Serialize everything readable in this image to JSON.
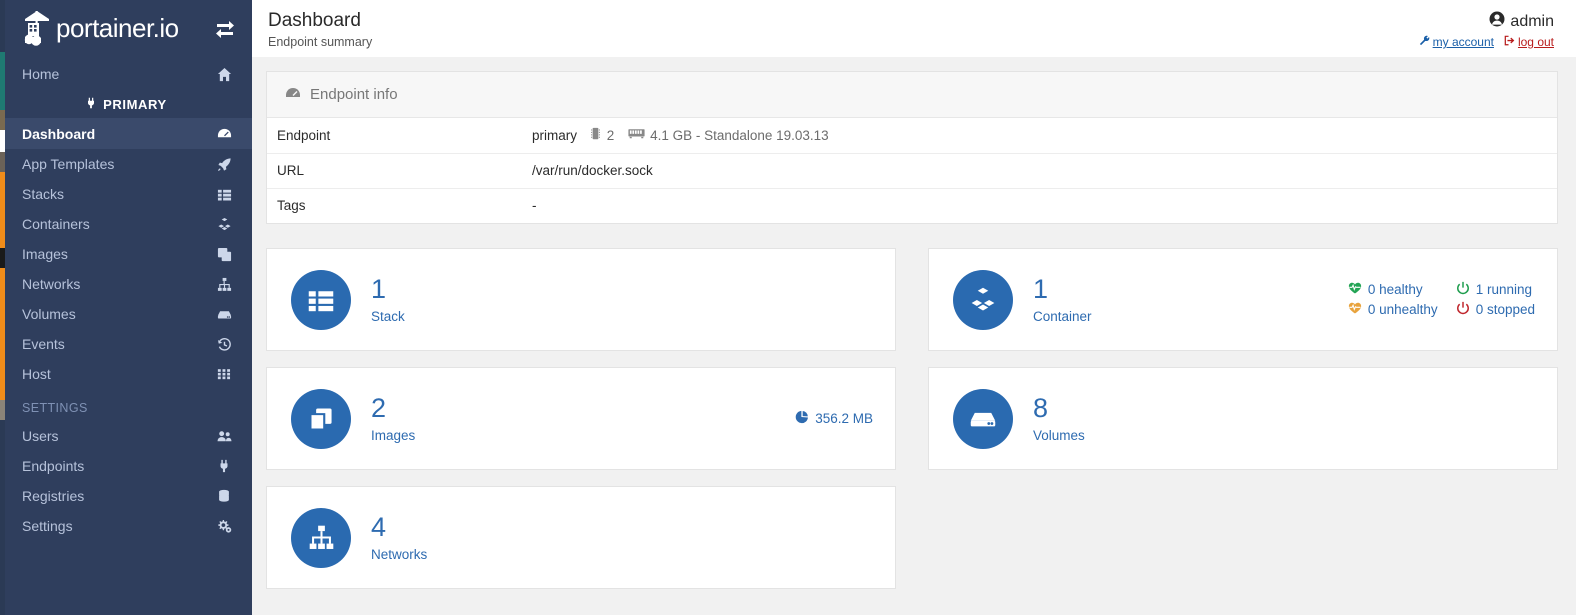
{
  "brand": {
    "name": "portainer.io",
    "toggle_icon": "exchange-arrows-icon"
  },
  "sidebar": {
    "home": {
      "label": "Home",
      "icon": "home-icon"
    },
    "primary_badge": {
      "label": "PRIMARY",
      "icon": "plug-icon"
    },
    "items": [
      {
        "label": "Dashboard",
        "icon": "tachometer-icon",
        "active": true
      },
      {
        "label": "App Templates",
        "icon": "rocket-icon",
        "active": false
      },
      {
        "label": "Stacks",
        "icon": "th-list-icon",
        "active": false
      },
      {
        "label": "Containers",
        "icon": "cubes-icon",
        "active": false
      },
      {
        "label": "Images",
        "icon": "clone-icon",
        "active": false
      },
      {
        "label": "Networks",
        "icon": "sitemap-icon",
        "active": false
      },
      {
        "label": "Volumes",
        "icon": "hdd-icon",
        "active": false
      },
      {
        "label": "Events",
        "icon": "history-icon",
        "active": false
      },
      {
        "label": "Host",
        "icon": "th-icon",
        "active": false
      }
    ],
    "settings_section": "SETTINGS",
    "settings_items": [
      {
        "label": "Users",
        "icon": "users-icon"
      },
      {
        "label": "Endpoints",
        "icon": "plug-icon"
      },
      {
        "label": "Registries",
        "icon": "database-icon"
      },
      {
        "label": "Settings",
        "icon": "cogs-icon"
      }
    ]
  },
  "header": {
    "title": "Dashboard",
    "subtitle": "Endpoint summary",
    "user": "admin",
    "user_icon": "user-circle-icon",
    "my_account": "my account",
    "my_account_icon": "wrench-icon",
    "log_out": "log out",
    "log_out_icon": "sign-out-icon"
  },
  "endpoint_panel": {
    "title": "Endpoint info",
    "title_icon": "tachometer-icon",
    "rows": [
      {
        "key": "Endpoint",
        "value": "primary"
      },
      {
        "key": "URL",
        "value": "/var/run/docker.sock"
      },
      {
        "key": "Tags",
        "value": "-"
      }
    ],
    "cpu_icon": "memory-icon",
    "cpu_count": "2",
    "ram_icon": "ram-icon",
    "ram_info": "4.1 GB - Standalone 19.03.13"
  },
  "cards": {
    "stack": {
      "count": "1",
      "label": "Stack",
      "icon": "th-list-icon"
    },
    "container": {
      "count": "1",
      "label": "Container",
      "icon": "cubes-icon",
      "stats": [
        {
          "label": "0 healthy",
          "icon": "heartbeat-icon",
          "color": "#23a455"
        },
        {
          "label": "1 running",
          "icon": "power-icon",
          "color": "#1f9d4e"
        },
        {
          "label": "0 unhealthy",
          "icon": "heartbeat-icon",
          "color": "#e8a33d"
        },
        {
          "label": "0 stopped",
          "icon": "power-icon",
          "color": "#c0272d"
        }
      ]
    },
    "images": {
      "count": "2",
      "label": "Images",
      "icon": "clone-icon",
      "size": "356.2 MB",
      "size_icon": "pie-chart-icon"
    },
    "volumes": {
      "count": "8",
      "label": "Volumes",
      "icon": "hdd-icon"
    },
    "networks": {
      "count": "4",
      "label": "Networks",
      "icon": "sitemap-icon"
    }
  },
  "colors": {
    "sidebar": "#2f3e5d",
    "sidebar_active": "#3a4a6b",
    "accent_blue": "#2e6bb0",
    "icon_circle": "#2a6ab0",
    "link_blue": "#1a5fa8",
    "link_red": "#b81c1c"
  }
}
